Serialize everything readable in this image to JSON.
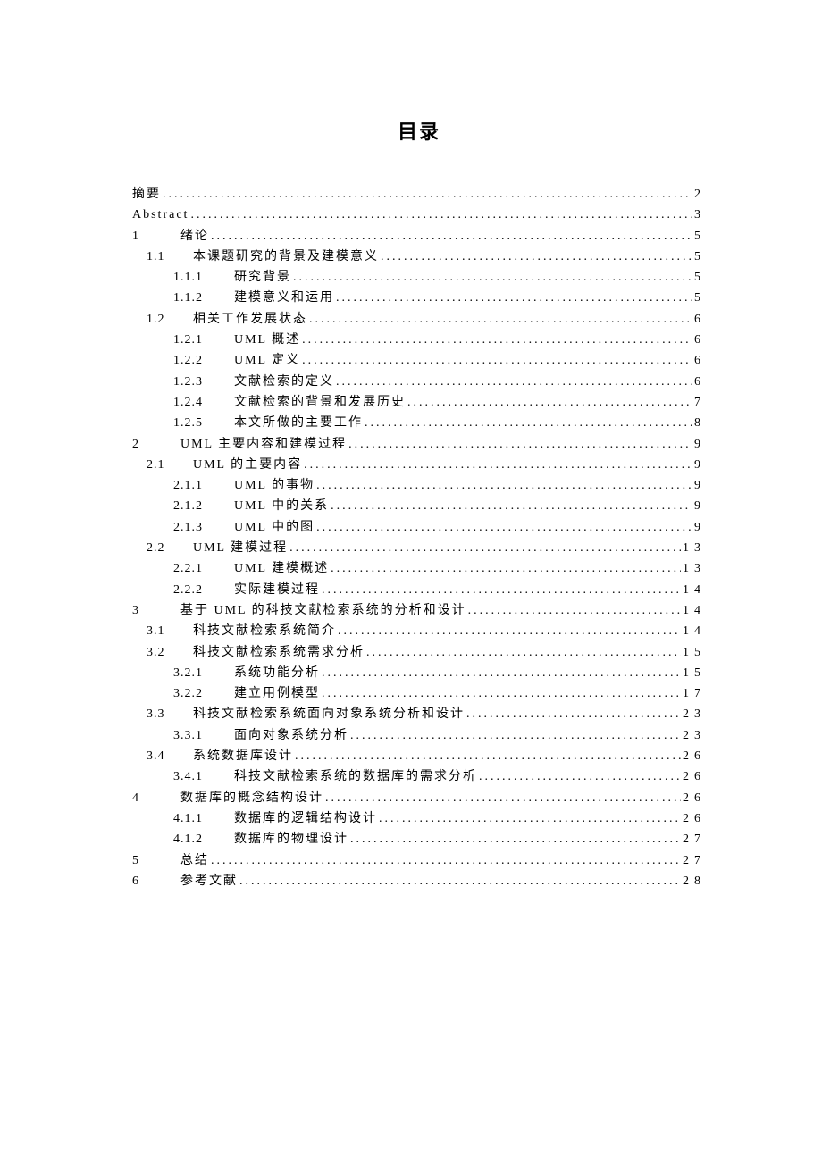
{
  "title": "目录",
  "entries": [
    {
      "level": 0,
      "num": "",
      "text": "摘要",
      "page": "2"
    },
    {
      "level": 0,
      "num": "",
      "text": "Abstract",
      "page": "3"
    },
    {
      "level": 0,
      "num": "1",
      "text": "绪论",
      "page": "5"
    },
    {
      "level": 1,
      "num": "1.1",
      "text": "本课题研究的背景及建模意义",
      "page": "5"
    },
    {
      "level": 2,
      "num": "1.1.1",
      "text": "研究背景",
      "page": "5"
    },
    {
      "level": 2,
      "num": "1.1.2",
      "text": "建模意义和运用",
      "page": "5"
    },
    {
      "level": 1,
      "num": "1.2",
      "text": "相关工作发展状态",
      "page": "6"
    },
    {
      "level": 2,
      "num": "1.2.1",
      "text": "UML 概述",
      "page": "6"
    },
    {
      "level": 2,
      "num": "1.2.2",
      "text": "UML 定义",
      "page": "6"
    },
    {
      "level": 2,
      "num": "1.2.3",
      "text": "文献检索的定义",
      "page": "6"
    },
    {
      "level": 2,
      "num": "1.2.4",
      "text": "文献检索的背景和发展历史",
      "page": "7"
    },
    {
      "level": 2,
      "num": "1.2.5",
      "text": "本文所做的主要工作",
      "page": "8"
    },
    {
      "level": 0,
      "num": "2",
      "text": "UML 主要内容和建模过程",
      "page": "9"
    },
    {
      "level": 1,
      "num": "2.1",
      "text": "UML 的主要内容",
      "page": "9"
    },
    {
      "level": 2,
      "num": "2.1.1",
      "text": "UML 的事物",
      "page": "9"
    },
    {
      "level": 2,
      "num": "2.1.2",
      "text": "UML 中的关系",
      "page": "9"
    },
    {
      "level": 2,
      "num": "2.1.3",
      "text": "UML 中的图",
      "page": "9"
    },
    {
      "level": 1,
      "num": "2.2",
      "text": "UML 建模过程",
      "page": "13"
    },
    {
      "level": 2,
      "num": "2.2.1",
      "text": "UML 建模概述",
      "page": "13"
    },
    {
      "level": 2,
      "num": "2.2.2",
      "text": "实际建模过程",
      "page": "14"
    },
    {
      "level": 0,
      "num": "3",
      "text": "基于 UML 的科技文献检索系统的分析和设计",
      "page": "14"
    },
    {
      "level": 1,
      "num": "3.1",
      "text": "科技文献检索系统简介",
      "page": "14"
    },
    {
      "level": 1,
      "num": "3.2",
      "text": "科技文献检索系统需求分析",
      "page": "15"
    },
    {
      "level": 2,
      "num": "3.2.1",
      "text": "系统功能分析",
      "page": "15"
    },
    {
      "level": 2,
      "num": "3.2.2",
      "text": "建立用例模型",
      "page": "17"
    },
    {
      "level": 1,
      "num": "3.3",
      "text": "科技文献检索系统面向对象系统分析和设计",
      "page": "23"
    },
    {
      "level": 2,
      "num": "3.3.1",
      "text": "面向对象系统分析",
      "page": "23"
    },
    {
      "level": 1,
      "num": "3.4",
      "text": "系统数据库设计",
      "page": "26"
    },
    {
      "level": 2,
      "num": "3.4.1",
      "text": "科技文献检索系统的数据库的需求分析",
      "page": "26"
    },
    {
      "level": 0,
      "num": "4",
      "text": "数据库的概念结构设计",
      "page": "26"
    },
    {
      "level": 2,
      "num": "4.1.1",
      "text": "数据库的逻辑结构设计",
      "page": "26"
    },
    {
      "level": 2,
      "num": "4.1.2",
      "text": "数据库的物理设计",
      "page": "27"
    },
    {
      "level": 0,
      "num": "5",
      "text": "总结",
      "page": "27"
    },
    {
      "level": 0,
      "num": "6",
      "text": "参考文献",
      "page": "28"
    }
  ]
}
